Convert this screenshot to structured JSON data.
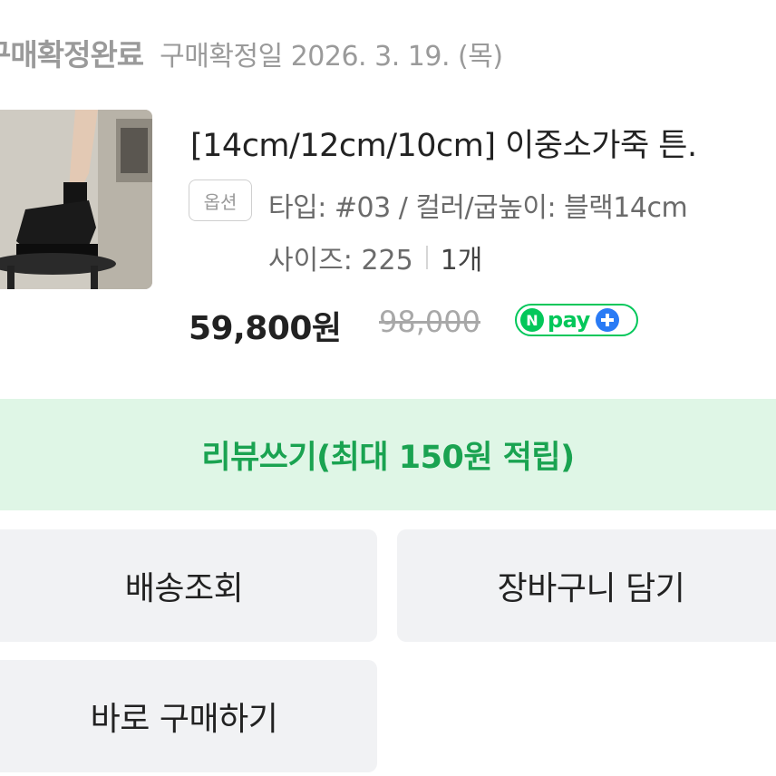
{
  "order": {
    "status": "구매확정완료",
    "confirm_date": "구매확정일 2026. 3. 19. (목)"
  },
  "product": {
    "name": "[14cm/12cm/10cm] 이중소가죽 튼.",
    "option_badge": "옵션",
    "option_line1": "타입: #03 / 컬러/굽높이: 블랙14cm",
    "option_size": "사이즈: 225",
    "quantity": "1개",
    "price": "59,800원",
    "original_price": "98,000",
    "npay_badge": {
      "n": "N",
      "text": "pay",
      "icon": "plus-icon"
    }
  },
  "actions": {
    "review": "리뷰쓰기(최대 150원 적립)",
    "track_delivery": "배송조회",
    "add_to_cart": "장바구니 담기",
    "buy_now": "바로 구매하기"
  },
  "colors": {
    "accent_green": "#1aa351",
    "review_bg": "#dff6e6",
    "npay_green": "#03c75a",
    "npay_blue": "#2a7bf5",
    "button_bg": "#f1f2f4"
  }
}
